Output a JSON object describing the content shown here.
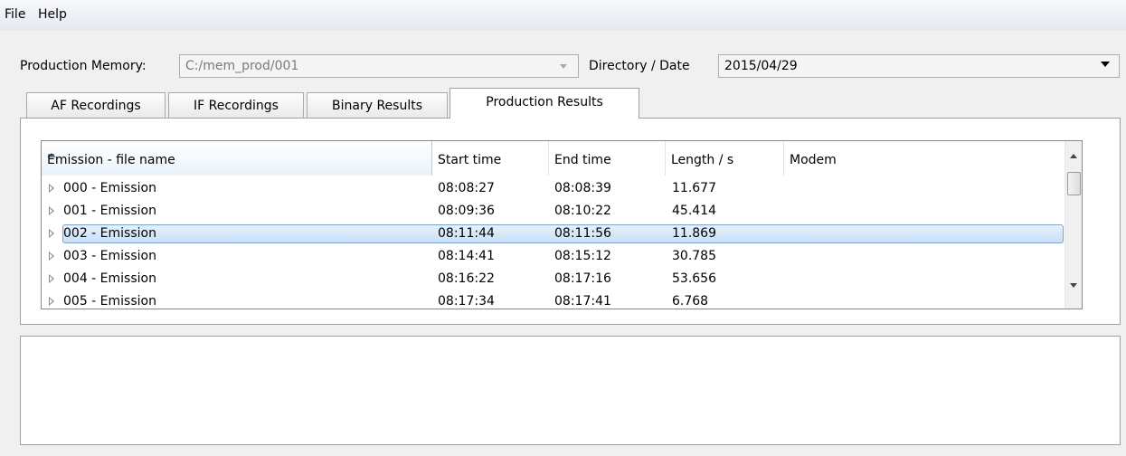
{
  "menu": {
    "file": "File",
    "help": "Help"
  },
  "production_memory": {
    "label": "Production Memory:",
    "value": "C:/mem_prod/001"
  },
  "directory_date": {
    "label": "Directory / Date",
    "value": "2015/04/29"
  },
  "tabs": [
    {
      "label": "AF Recordings"
    },
    {
      "label": "IF Recordings"
    },
    {
      "label": "Binary Results"
    },
    {
      "label": "Production Results",
      "active": true
    }
  ],
  "table": {
    "columns": [
      "Emission - file name",
      "Start time",
      "End time",
      "Length / s",
      "Modem"
    ],
    "sort_column": "Emission - file name",
    "sort_direction": "ascending",
    "selected_row": 2,
    "rows": [
      {
        "name": "000 - Emission",
        "start": "08:08:27",
        "end": "08:08:39",
        "length": "11.677",
        "modem": ""
      },
      {
        "name": "001 - Emission",
        "start": "08:09:36",
        "end": "08:10:22",
        "length": "45.414",
        "modem": ""
      },
      {
        "name": "002 - Emission",
        "start": "08:11:44",
        "end": "08:11:56",
        "length": "11.869",
        "modem": ""
      },
      {
        "name": "003 - Emission",
        "start": "08:14:41",
        "end": "08:15:12",
        "length": "30.785",
        "modem": ""
      },
      {
        "name": "004 - Emission",
        "start": "08:16:22",
        "end": "08:17:16",
        "length": "53.656",
        "modem": ""
      },
      {
        "name": "005 - Emission",
        "start": "08:17:34",
        "end": "08:17:41",
        "length": "6.768",
        "modem": ""
      }
    ]
  },
  "colors": {
    "selection": "#cce4f7",
    "selection_border": "#7da2ce",
    "sort_caret": "#5b86b2"
  }
}
